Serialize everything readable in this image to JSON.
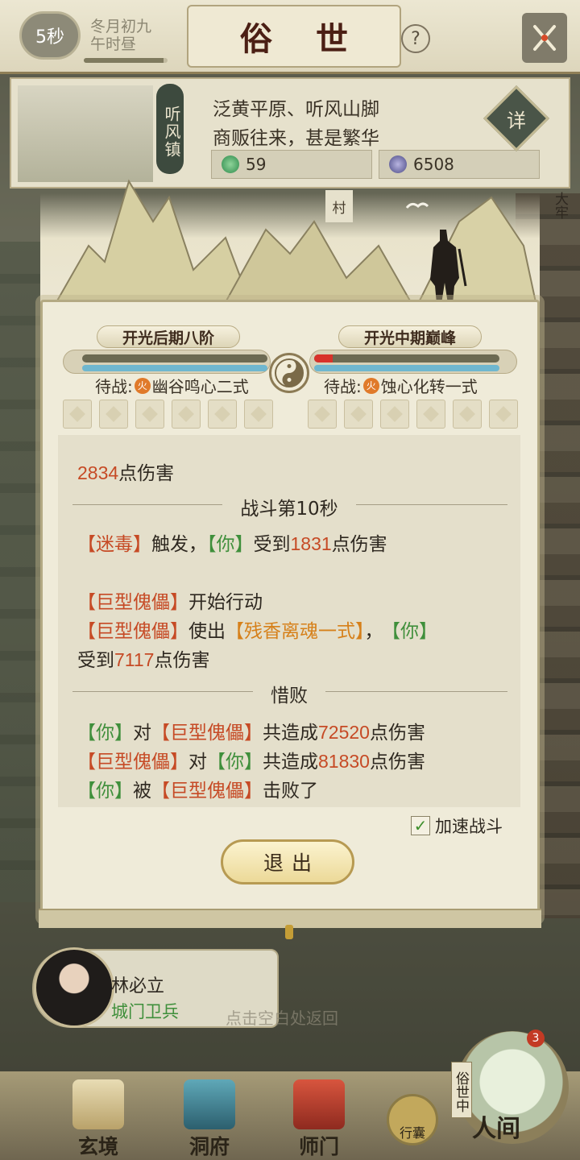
{
  "header": {
    "timer": "5秒",
    "date_line1": "冬月初九",
    "date_line2": "午时昼",
    "title": "俗 世",
    "help": "?"
  },
  "location": {
    "town": "听风镇",
    "desc_line1": "泛黄平原、听风山脚",
    "desc_line2": "商贩往来，甚是繁华",
    "resource1": "59",
    "resource2": "6508",
    "detail": "详"
  },
  "scene": {
    "village_sign": "村",
    "prison_sign": "大牢"
  },
  "battle": {
    "left_realm": "开光后期八阶",
    "right_realm": "开光中期巅峰",
    "left_hp_percent": 100,
    "left_mp_percent": 100,
    "right_hp_percent": 10,
    "right_mp_percent": 100,
    "waiting_label": "待战:",
    "fire_badge": "火",
    "left_skill": "幽谷鸣心二式",
    "right_skill": "蚀心化转一式"
  },
  "log": {
    "line1_num": "2834",
    "line1_text": "点伤害",
    "sep1": "战斗第10秒",
    "l2_a": "【迷毒】",
    "l2_b": "触发，",
    "l2_c": "【你】",
    "l2_d": "受到",
    "l2_num": "1831",
    "l2_e": "点伤害",
    "l3_a": "【巨型傀儡】",
    "l3_b": "开始行动",
    "l4_a": "【巨型傀儡】",
    "l4_b": "使出",
    "l4_c": "【残香离魂一式】",
    "l4_d": "，",
    "l4_e": "【你】",
    "l5_a": "受到",
    "l5_num": "7117",
    "l5_b": "点伤害",
    "sep2": "惜败",
    "r1_a": "【你】",
    "r1_b": "对",
    "r1_c": "【巨型傀儡】",
    "r1_d": "共造成",
    "r1_num": "72520",
    "r1_e": "点伤害",
    "r2_a": "【巨型傀儡】",
    "r2_b": "对",
    "r2_c": "【你】",
    "r2_d": "共造成",
    "r2_num": "81830",
    "r2_e": "点伤害",
    "r3_a": "【你】",
    "r3_b": "被",
    "r3_c": "【巨型傀儡】",
    "r3_d": "击败了"
  },
  "controls": {
    "speed_label": "加速战斗",
    "speed_checked": true,
    "exit_label": "退出"
  },
  "npc": {
    "name": "林必立",
    "title": "城门卫兵",
    "hint": "点击空白处返回"
  },
  "nav": {
    "items": [
      {
        "label": "玄境"
      },
      {
        "label": "洞府"
      },
      {
        "label": "师门"
      }
    ],
    "bag": "行囊",
    "world_tag": "俗世中",
    "world_label": "人间",
    "notif_count": "3"
  },
  "colors": {
    "damage_red": "#c64a25",
    "player_green": "#3f8f3b",
    "skill_orange": "#d6801a"
  }
}
